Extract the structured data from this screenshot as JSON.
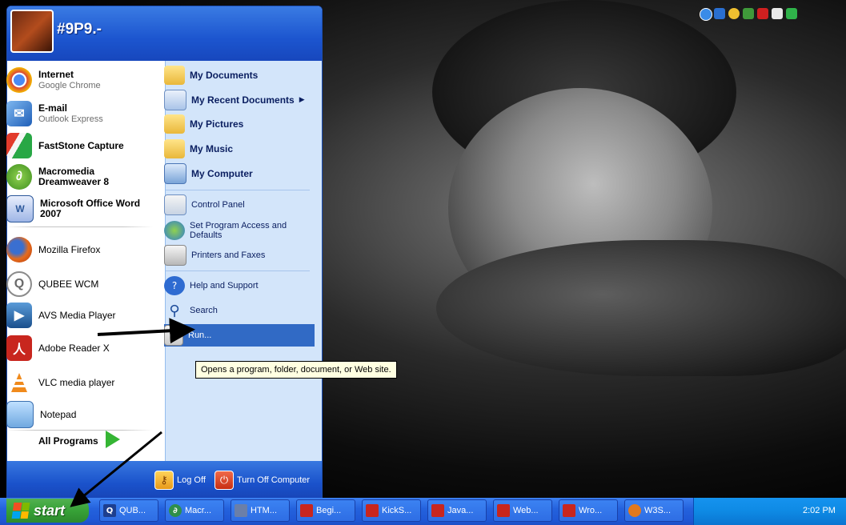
{
  "start_menu": {
    "username": "#9P9.-",
    "pinned": [
      {
        "title": "Internet",
        "subtitle": "Google Chrome",
        "icon": "chrome-icon"
      },
      {
        "title": "E-mail",
        "subtitle": "Outlook Express",
        "icon": "outlook-icon"
      },
      {
        "title": "FastStone Capture",
        "icon": "faststone-icon"
      },
      {
        "title": "Macromedia Dreamweaver 8",
        "icon": "dreamweaver-icon"
      },
      {
        "title": "Microsoft Office Word 2007",
        "icon": "word-icon"
      }
    ],
    "recent": [
      {
        "label": "Mozilla Firefox",
        "icon": "firefox-icon"
      },
      {
        "label": "QUBEE WCM",
        "icon": "qubee-icon"
      },
      {
        "label": "AVS Media Player",
        "icon": "avs-icon"
      },
      {
        "label": "Adobe Reader X",
        "icon": "adobe-reader-icon"
      },
      {
        "label": "VLC media player",
        "icon": "vlc-icon"
      },
      {
        "label": "Notepad",
        "icon": "notepad-icon"
      }
    ],
    "all_programs": "All Programs",
    "places": [
      {
        "label": "My Documents",
        "icon": "folder-icon"
      },
      {
        "label": "My Recent Documents",
        "icon": "recent-icon"
      },
      {
        "label": "My Pictures",
        "icon": "folder-icon"
      },
      {
        "label": "My Music",
        "icon": "folder-icon"
      },
      {
        "label": "My Computer",
        "icon": "computer-icon"
      }
    ],
    "system": [
      {
        "label": "Control Panel",
        "icon": "control-panel-icon"
      },
      {
        "label": "Set Program Access and Defaults",
        "icon": "defaults-icon"
      },
      {
        "label": "Printers and Faxes",
        "icon": "printer-icon"
      }
    ],
    "tools": [
      {
        "label": "Help and Support",
        "icon": "help-icon"
      },
      {
        "label": "Search",
        "icon": "search-icon"
      },
      {
        "label": "Run...",
        "icon": "run-icon"
      }
    ],
    "tooltip": "Opens a program, folder, document, or Web site.",
    "log_off": "Log Off",
    "turn_off": "Turn Off Computer"
  },
  "taskbar": {
    "start_label": "start",
    "items": [
      {
        "label": "QUB...",
        "icon": "qubee-icon",
        "color": "#1d3f8f"
      },
      {
        "label": "Macr...",
        "icon": "dreamweaver-icon",
        "color": "#2f8f4a"
      },
      {
        "label": "HTM...",
        "icon": "document-icon",
        "color": "#6b7fa8"
      },
      {
        "label": "Begi...",
        "icon": "pdf-icon",
        "color": "#c8261e"
      },
      {
        "label": "KickS...",
        "icon": "pdf-icon",
        "color": "#c8261e"
      },
      {
        "label": "Java...",
        "icon": "pdf-icon",
        "color": "#c8261e"
      },
      {
        "label": "Web...",
        "icon": "pdf-icon",
        "color": "#c8261e"
      },
      {
        "label": "Wro...",
        "icon": "pdf-icon",
        "color": "#c8261e"
      },
      {
        "label": "W3S...",
        "icon": "firefox-icon",
        "color": "#e2791d"
      }
    ],
    "clock": "2:02 PM"
  },
  "colors": {
    "start_button": "#37a237",
    "taskbar": "#2462dd",
    "highlight": "#316ac5",
    "tooltip_bg": "#ffffe1"
  }
}
